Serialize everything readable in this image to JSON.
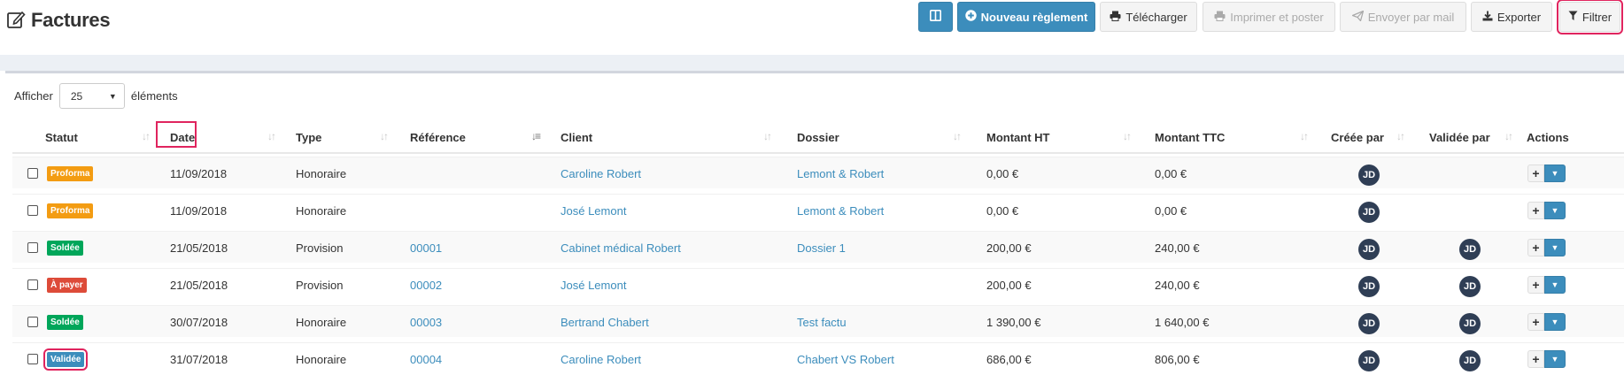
{
  "header": {
    "title": "Factures",
    "buttons": {
      "columns": "",
      "nouveau_reglement": "Nouveau règlement",
      "telecharger": "Télécharger",
      "imprimer": "Imprimer et poster",
      "envoyer": "Envoyer par mail",
      "exporter": "Exporter",
      "filtrer": "Filtrer"
    }
  },
  "length": {
    "before": "Afficher",
    "value": "25",
    "after": "éléments"
  },
  "columns": {
    "statut": "Statut",
    "date": "Date",
    "type": "Type",
    "reference": "Référence",
    "client": "Client",
    "dossier": "Dossier",
    "montant_ht": "Montant HT",
    "montant_ttc": "Montant TTC",
    "creee_par": "Créée par",
    "validee_par": "Validée par",
    "actions": "Actions"
  },
  "rows": [
    {
      "statut": "Proforma",
      "date": "11/09/2018",
      "type": "Honoraire",
      "reference": "",
      "client": "Caroline Robert",
      "dossier": "Lemont & Robert",
      "ht": "0,00 €",
      "ttc": "0,00 €",
      "creee": "JD",
      "validee": ""
    },
    {
      "statut": "Proforma",
      "date": "11/09/2018",
      "type": "Honoraire",
      "reference": "",
      "client": "José Lemont",
      "dossier": "Lemont & Robert",
      "ht": "0,00 €",
      "ttc": "0,00 €",
      "creee": "JD",
      "validee": ""
    },
    {
      "statut": "Soldée",
      "date": "21/05/2018",
      "type": "Provision",
      "reference": "00001",
      "client": "Cabinet médical Robert",
      "dossier": "Dossier 1",
      "ht": "200,00 €",
      "ttc": "240,00 €",
      "creee": "JD",
      "validee": "JD"
    },
    {
      "statut": "À payer",
      "date": "21/05/2018",
      "type": "Provision",
      "reference": "00002",
      "client": "José Lemont",
      "dossier": "",
      "ht": "200,00 €",
      "ttc": "240,00 €",
      "creee": "JD",
      "validee": "JD"
    },
    {
      "statut": "Soldée",
      "date": "30/07/2018",
      "type": "Honoraire",
      "reference": "00003",
      "client": "Bertrand Chabert",
      "dossier": "Test factu",
      "ht": "1 390,00 €",
      "ttc": "1 640,00 €",
      "creee": "JD",
      "validee": "JD"
    },
    {
      "statut": "Validée",
      "date": "31/07/2018",
      "type": "Honoraire",
      "reference": "00004",
      "client": "Caroline Robert",
      "dossier": "Chabert VS Robert",
      "ht": "686,00 €",
      "ttc": "806,00 €",
      "creee": "JD",
      "validee": "JD"
    }
  ],
  "status_colors": {
    "Proforma": "#f39c12",
    "Soldée": "#00a65a",
    "À payer": "#dd4b39",
    "Validée": "#3c8dbc"
  },
  "icons": {
    "title": "edit-icon",
    "columns": "columns-icon",
    "nouveau": "plus-circle-icon",
    "telecharger": "print-icon",
    "imprimer": "print-icon",
    "envoyer": "send-icon",
    "exporter": "download-icon",
    "filtrer": "filter-icon"
  }
}
